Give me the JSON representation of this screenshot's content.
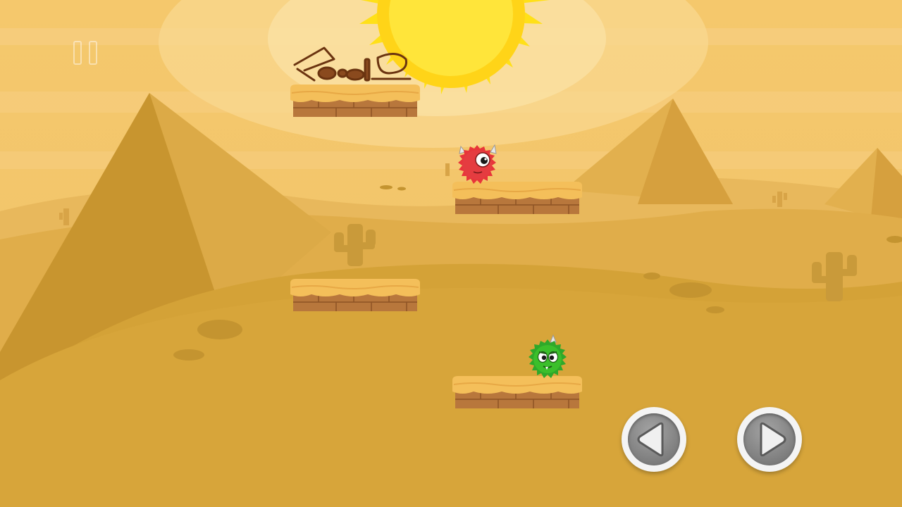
{
  "game": {
    "hud": {
      "pause_icon": "pause-icon"
    },
    "controls": {
      "left_icon": "arrow-left-icon",
      "right_icon": "arrow-right-icon"
    },
    "characters": {
      "player_icon": "green-monster-icon",
      "enemy_icon": "red-monster-icon"
    },
    "collectible_icon": "rubble-pile-icon",
    "colors": {
      "sky": "#f2c46a",
      "sand": "#d6a536",
      "pyramid_light": "#dfae4a",
      "pyramid_shadow": "#c99630",
      "sun": "#ffe21a",
      "platform_top": "#f4bf5a",
      "platform_brick": "#b8773c",
      "button_ring": "#f4f4f4",
      "button_core": "#8a8a8a",
      "player": "#3bbf2b",
      "enemy": "#e8353a"
    }
  }
}
